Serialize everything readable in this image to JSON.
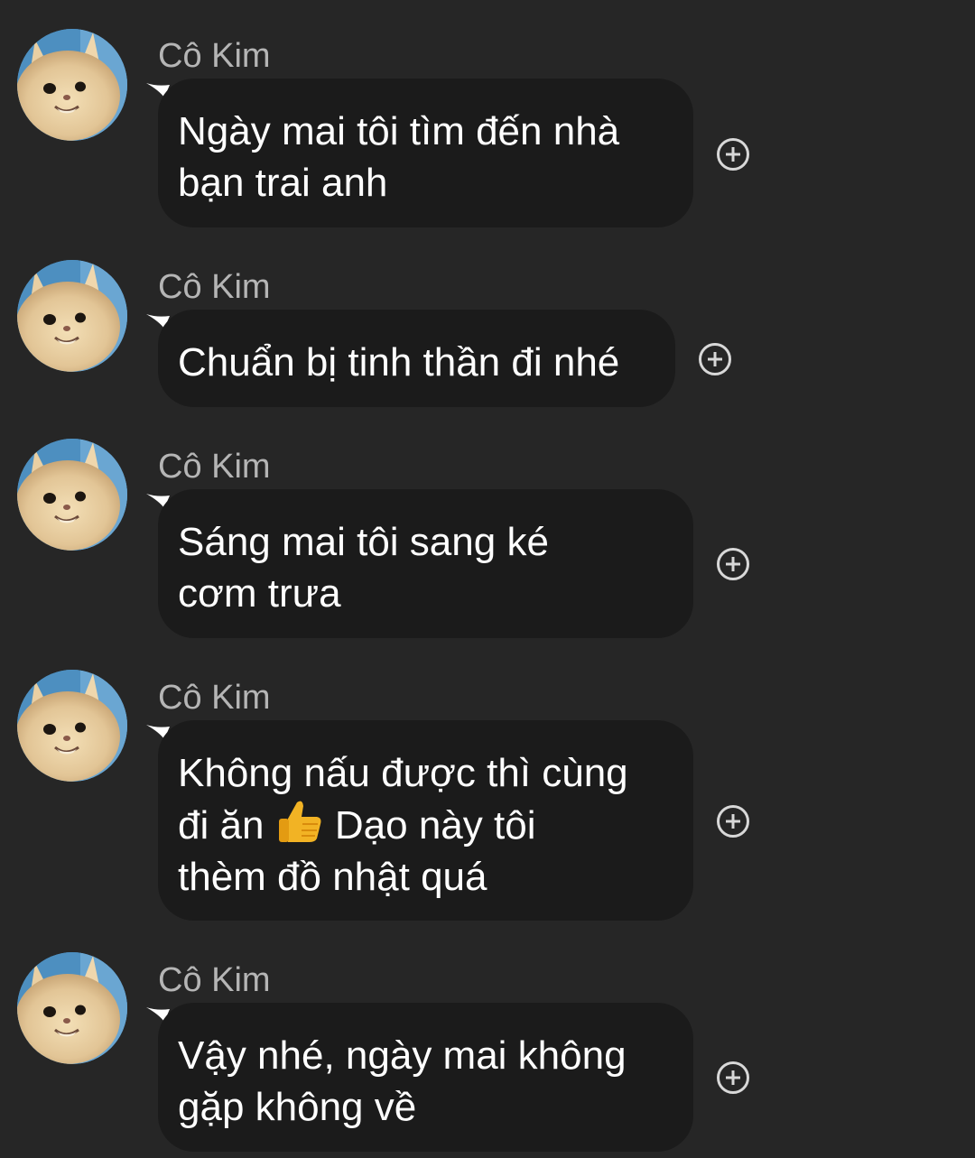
{
  "messages": [
    {
      "sender": "Cô Kim",
      "lines": [
        "Ngày mai tôi tìm đến nhà",
        "bạn trai anh"
      ],
      "avatar_icon": "cat-avatar"
    },
    {
      "sender": "Cô Kim",
      "lines": [
        "Chuẩn bị tinh thần đi nhé"
      ],
      "avatar_icon": "cat-avatar"
    },
    {
      "sender": "Cô Kim",
      "lines": [
        "Sáng mai tôi sang ké",
        "cơm trưa"
      ],
      "avatar_icon": "cat-avatar"
    },
    {
      "sender": "Cô Kim",
      "lines": [
        "Không nấu được thì cùng",
        "đi ăn",
        "Dạo này tôi",
        "thèm đồ nhật quá"
      ],
      "emoji": "thumbs-up",
      "avatar_icon": "cat-avatar"
    },
    {
      "sender": "Cô Kim",
      "lines": [
        "Vậy nhé, ngày mai không",
        "gặp không về"
      ],
      "avatar_icon": "cat-avatar"
    }
  ],
  "icons": {
    "reaction": "add-reaction-icon",
    "thumb": "thumbs-up-icon"
  },
  "colors": {
    "background": "#262626",
    "bubble": "#1b1b1b",
    "sender_text": "#b5b5b5",
    "message_text": "#ffffff"
  }
}
